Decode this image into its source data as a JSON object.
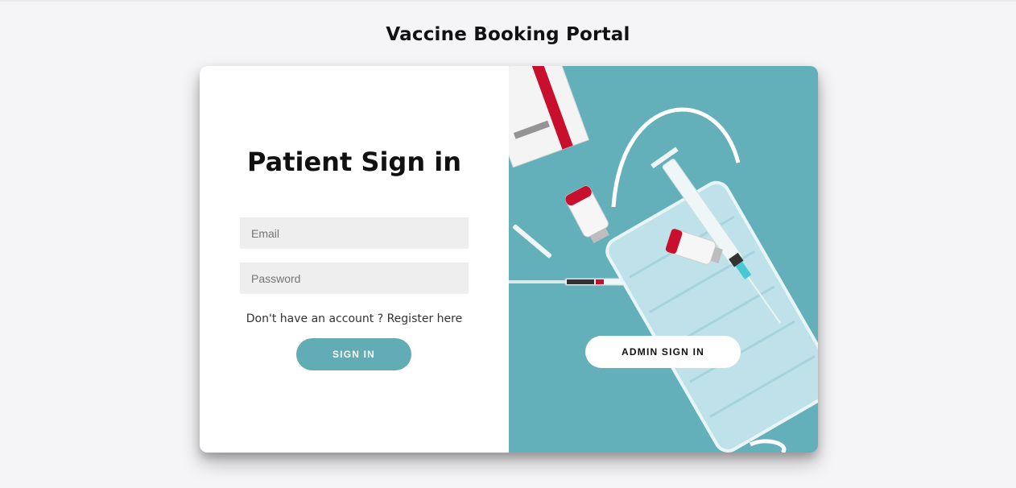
{
  "header": {
    "title": "Vaccine Booking Portal"
  },
  "patient_panel": {
    "heading": "Patient Sign in",
    "email_placeholder": "Email",
    "password_placeholder": "Password",
    "register_text": "Don't have an account ? Register here",
    "signin_label": "SIGN IN"
  },
  "admin_panel": {
    "admin_signin_label": "ADMIN SIGN IN"
  },
  "colors": {
    "accent": "#62acb5",
    "panel_background": "#67b3bc",
    "page_background": "#f5f5f7",
    "input_background": "#eeeeee"
  }
}
